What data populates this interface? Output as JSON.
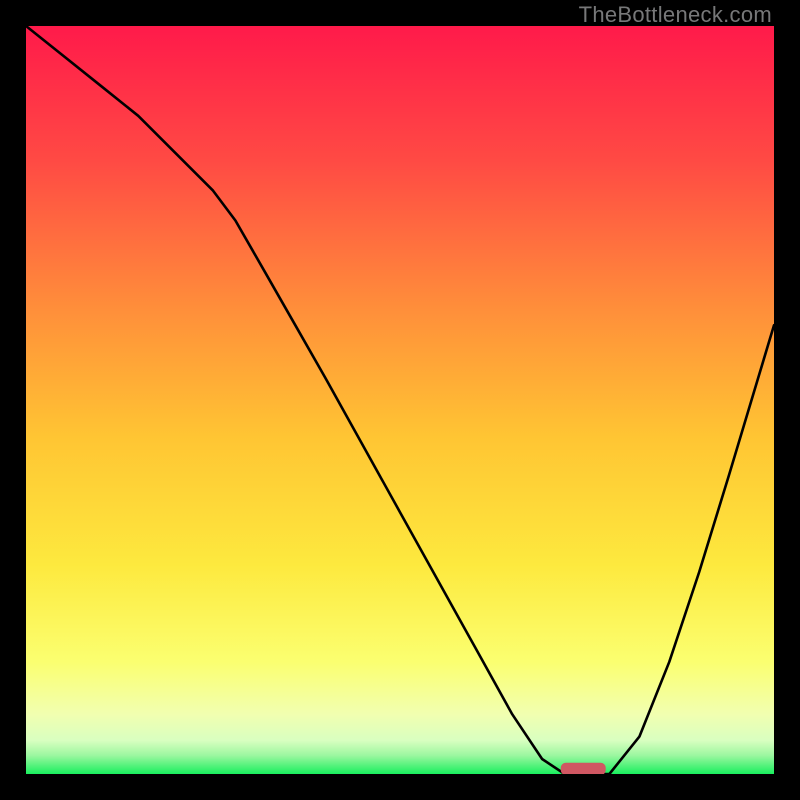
{
  "watermark": "TheBottleneck.com",
  "colors": {
    "gradient_top": "#ff1a4a",
    "gradient_mid_upper": "#ff6b3d",
    "gradient_mid": "#ffc533",
    "gradient_mid_lower": "#fff44a",
    "gradient_pale": "#f6ffb0",
    "gradient_green": "#1cf060",
    "curve": "#000000",
    "marker": "#d05762"
  },
  "chart_data": {
    "type": "line",
    "title": "",
    "xlabel": "",
    "ylabel": "",
    "xlim": [
      0,
      100
    ],
    "ylim": [
      0,
      100
    ],
    "curve": {
      "x": [
        0,
        5,
        10,
        15,
        20,
        25,
        28,
        32,
        36,
        40,
        45,
        50,
        55,
        60,
        65,
        69,
        72,
        75,
        78,
        82,
        86,
        90,
        94,
        100
      ],
      "y": [
        100,
        96,
        92,
        88,
        83,
        78,
        74,
        67,
        60,
        53,
        44,
        35,
        26,
        17,
        8,
        2,
        0,
        0,
        0,
        5,
        15,
        27,
        40,
        60
      ]
    },
    "marker": {
      "x_start": 71.5,
      "x_end": 77.5,
      "y": 0,
      "thickness": 1.5
    }
  }
}
